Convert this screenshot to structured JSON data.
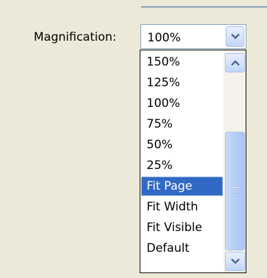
{
  "magnification": {
    "label": "Magnification:",
    "selected_value": "100%"
  },
  "dropdown": {
    "options": [
      "150%",
      "125%",
      "100%",
      "75%",
      "50%",
      "25%",
      "Fit Page",
      "Fit Width",
      "Fit Visible",
      "Default"
    ],
    "highlighted": "Fit Page"
  },
  "scrollbar": {
    "position": 0.6
  },
  "icons": {
    "combo_button": "chevron-down-icon",
    "scroll_up": "chevron-up-icon",
    "scroll_down": "chevron-down-icon",
    "thumb_grip": "grip-lines-icon"
  },
  "colors": {
    "dialog_background": "#ECE9D8",
    "highlight": "#316AC5",
    "field_border": "#7F9DB9",
    "arrow_color": "#4D6185"
  }
}
